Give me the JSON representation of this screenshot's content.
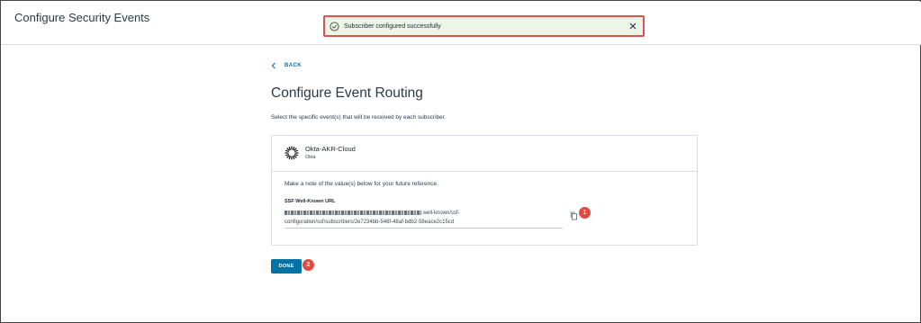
{
  "header": {
    "title": "Configure Security Events"
  },
  "toast": {
    "message": "Subscriber configured successfully",
    "icon": "check-circle-icon",
    "close_icon": "close-icon",
    "highlight_color": "#d9534f",
    "background": "#edf6e6"
  },
  "back": {
    "label": "BACK",
    "icon": "chevron-left-icon"
  },
  "page": {
    "title": "Configure Event Routing",
    "subtitle": "Select the specific event(s) that will be received by each subscriber."
  },
  "subscriber": {
    "name": "Okta-AKR-Cloud",
    "type": "Okta",
    "logo": "okta-sunburst-logo",
    "note": "Make a note of the value(s) below for your future reference.",
    "url_label": "SSF Well-Known URL",
    "url_line1_visible": ".well-known/ssf-",
    "url_line2": "configuration/ssf/subscribers/2e7234bb-546f-48af-bdb2-58eace2c15cd",
    "copy_icon": "copy-icon"
  },
  "annotations": [
    "1",
    "2"
  ],
  "actions": {
    "done_label": "DONE"
  },
  "colors": {
    "accent": "#0072a3",
    "link": "#0070b0",
    "annotation_badge": "#dc4b44"
  }
}
